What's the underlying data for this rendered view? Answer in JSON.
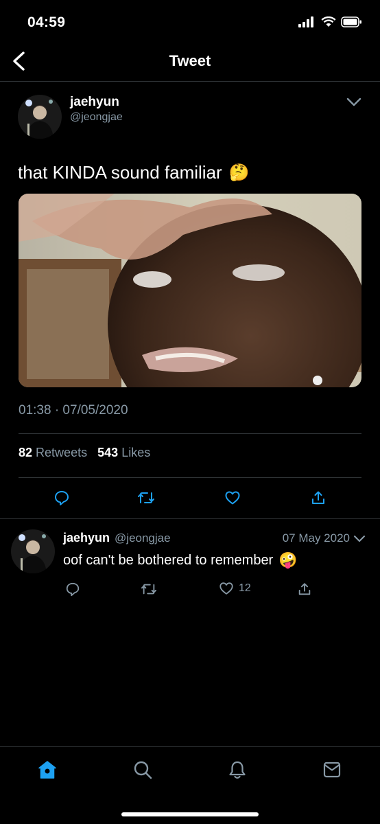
{
  "status_bar": {
    "time": "04:59"
  },
  "nav": {
    "title": "Tweet"
  },
  "tweet": {
    "author_name": "jaehyun",
    "author_handle": "@jeongjae",
    "text": "that KINDA sound familiar",
    "emoji": "🤔",
    "timestamp": "01:38 · 07/05/2020",
    "retweet_count": "82",
    "retweet_label": "Retweets",
    "like_count": "543",
    "like_label": "Likes"
  },
  "reply": {
    "author_name": "jaehyun",
    "author_handle": "@jeongjae",
    "date": "07 May 2020",
    "text": "oof can't be bothered to remember",
    "emoji": "🤪",
    "like_count": "12"
  },
  "tab_bar": {
    "items": [
      "home-icon",
      "search-icon",
      "notifications-icon",
      "messages-icon"
    ],
    "active_color": "#1da1f2"
  },
  "colors": {
    "background": "#000000",
    "muted": "#8899a6",
    "divider": "#2f3336",
    "accent": "#1da1f2"
  }
}
